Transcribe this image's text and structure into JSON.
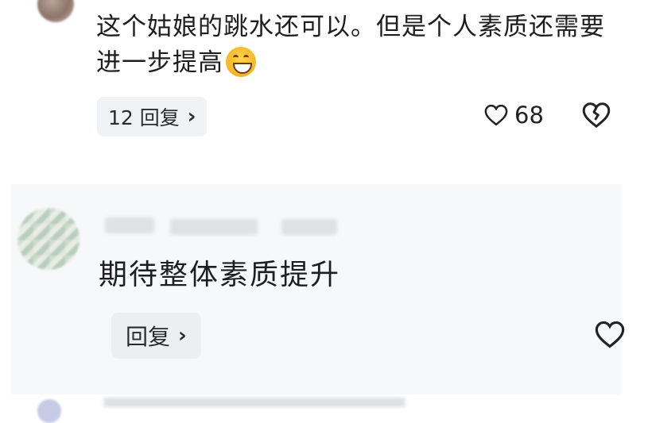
{
  "comments": [
    {
      "text": "这个姑娘的跳水还可以。但是个人素质还需要进一步提高",
      "emoji": "laughing-emoji",
      "reply_label": "12 回复",
      "likes": "68"
    },
    {
      "text": "期待整体素质提升",
      "reply_label": "回复"
    }
  ],
  "icons": {
    "like": "heart-outline-icon",
    "dislike": "broken-heart-icon",
    "chevron": "chevron-right-icon"
  },
  "colors": {
    "reply_bg": "#f1f2f5",
    "card_bg": "#f7f8fa",
    "text": "#1e1e1e"
  }
}
